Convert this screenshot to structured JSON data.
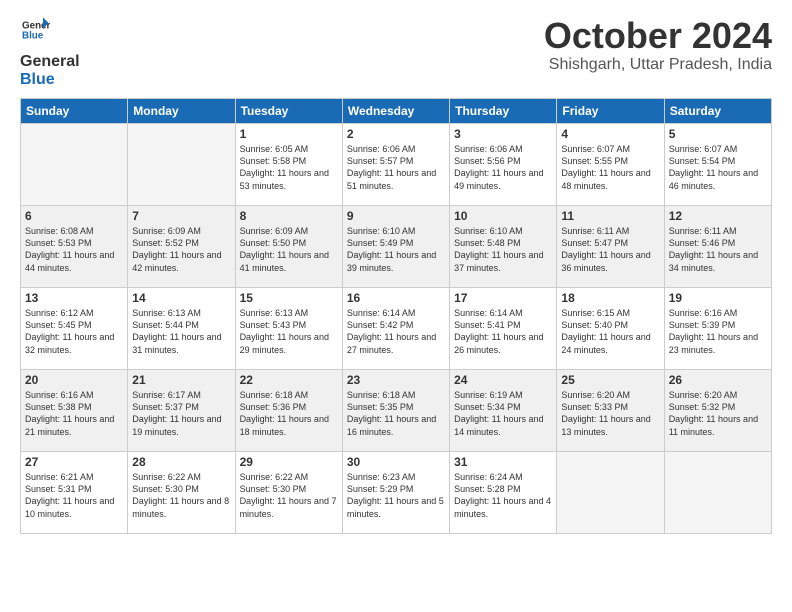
{
  "logo": {
    "line1": "General",
    "line2": "Blue"
  },
  "title": "October 2024",
  "location": "Shishgarh, Uttar Pradesh, India",
  "days_of_week": [
    "Sunday",
    "Monday",
    "Tuesday",
    "Wednesday",
    "Thursday",
    "Friday",
    "Saturday"
  ],
  "weeks": [
    [
      {
        "day": "",
        "content": ""
      },
      {
        "day": "",
        "content": ""
      },
      {
        "day": "1",
        "sunrise": "6:05 AM",
        "sunset": "5:58 PM",
        "daylight": "11 hours and 53 minutes."
      },
      {
        "day": "2",
        "sunrise": "6:06 AM",
        "sunset": "5:57 PM",
        "daylight": "11 hours and 51 minutes."
      },
      {
        "day": "3",
        "sunrise": "6:06 AM",
        "sunset": "5:56 PM",
        "daylight": "11 hours and 49 minutes."
      },
      {
        "day": "4",
        "sunrise": "6:07 AM",
        "sunset": "5:55 PM",
        "daylight": "11 hours and 48 minutes."
      },
      {
        "day": "5",
        "sunrise": "6:07 AM",
        "sunset": "5:54 PM",
        "daylight": "11 hours and 46 minutes."
      }
    ],
    [
      {
        "day": "6",
        "sunrise": "6:08 AM",
        "sunset": "5:53 PM",
        "daylight": "11 hours and 44 minutes."
      },
      {
        "day": "7",
        "sunrise": "6:09 AM",
        "sunset": "5:52 PM",
        "daylight": "11 hours and 42 minutes."
      },
      {
        "day": "8",
        "sunrise": "6:09 AM",
        "sunset": "5:50 PM",
        "daylight": "11 hours and 41 minutes."
      },
      {
        "day": "9",
        "sunrise": "6:10 AM",
        "sunset": "5:49 PM",
        "daylight": "11 hours and 39 minutes."
      },
      {
        "day": "10",
        "sunrise": "6:10 AM",
        "sunset": "5:48 PM",
        "daylight": "11 hours and 37 minutes."
      },
      {
        "day": "11",
        "sunrise": "6:11 AM",
        "sunset": "5:47 PM",
        "daylight": "11 hours and 36 minutes."
      },
      {
        "day": "12",
        "sunrise": "6:11 AM",
        "sunset": "5:46 PM",
        "daylight": "11 hours and 34 minutes."
      }
    ],
    [
      {
        "day": "13",
        "sunrise": "6:12 AM",
        "sunset": "5:45 PM",
        "daylight": "11 hours and 32 minutes."
      },
      {
        "day": "14",
        "sunrise": "6:13 AM",
        "sunset": "5:44 PM",
        "daylight": "11 hours and 31 minutes."
      },
      {
        "day": "15",
        "sunrise": "6:13 AM",
        "sunset": "5:43 PM",
        "daylight": "11 hours and 29 minutes."
      },
      {
        "day": "16",
        "sunrise": "6:14 AM",
        "sunset": "5:42 PM",
        "daylight": "11 hours and 27 minutes."
      },
      {
        "day": "17",
        "sunrise": "6:14 AM",
        "sunset": "5:41 PM",
        "daylight": "11 hours and 26 minutes."
      },
      {
        "day": "18",
        "sunrise": "6:15 AM",
        "sunset": "5:40 PM",
        "daylight": "11 hours and 24 minutes."
      },
      {
        "day": "19",
        "sunrise": "6:16 AM",
        "sunset": "5:39 PM",
        "daylight": "11 hours and 23 minutes."
      }
    ],
    [
      {
        "day": "20",
        "sunrise": "6:16 AM",
        "sunset": "5:38 PM",
        "daylight": "11 hours and 21 minutes."
      },
      {
        "day": "21",
        "sunrise": "6:17 AM",
        "sunset": "5:37 PM",
        "daylight": "11 hours and 19 minutes."
      },
      {
        "day": "22",
        "sunrise": "6:18 AM",
        "sunset": "5:36 PM",
        "daylight": "11 hours and 18 minutes."
      },
      {
        "day": "23",
        "sunrise": "6:18 AM",
        "sunset": "5:35 PM",
        "daylight": "11 hours and 16 minutes."
      },
      {
        "day": "24",
        "sunrise": "6:19 AM",
        "sunset": "5:34 PM",
        "daylight": "11 hours and 14 minutes."
      },
      {
        "day": "25",
        "sunrise": "6:20 AM",
        "sunset": "5:33 PM",
        "daylight": "11 hours and 13 minutes."
      },
      {
        "day": "26",
        "sunrise": "6:20 AM",
        "sunset": "5:32 PM",
        "daylight": "11 hours and 11 minutes."
      }
    ],
    [
      {
        "day": "27",
        "sunrise": "6:21 AM",
        "sunset": "5:31 PM",
        "daylight": "11 hours and 10 minutes."
      },
      {
        "day": "28",
        "sunrise": "6:22 AM",
        "sunset": "5:30 PM",
        "daylight": "11 hours and 8 minutes."
      },
      {
        "day": "29",
        "sunrise": "6:22 AM",
        "sunset": "5:30 PM",
        "daylight": "11 hours and 7 minutes."
      },
      {
        "day": "30",
        "sunrise": "6:23 AM",
        "sunset": "5:29 PM",
        "daylight": "11 hours and 5 minutes."
      },
      {
        "day": "31",
        "sunrise": "6:24 AM",
        "sunset": "5:28 PM",
        "daylight": "11 hours and 4 minutes."
      },
      {
        "day": "",
        "content": ""
      },
      {
        "day": "",
        "content": ""
      }
    ]
  ]
}
